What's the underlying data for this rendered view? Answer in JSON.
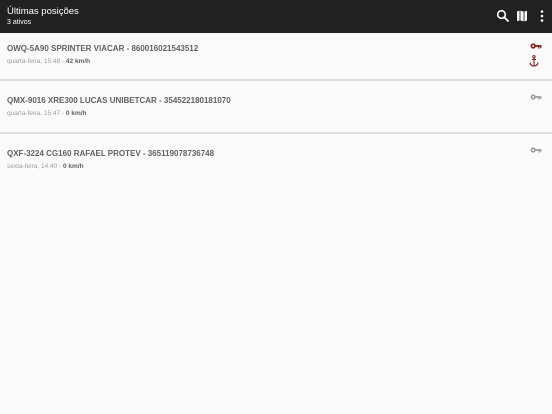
{
  "appbar": {
    "title": "Últimas posições",
    "subtitle": "3 ativos",
    "icons": [
      "search-icon",
      "map-icon",
      "more-vert-icon"
    ]
  },
  "colors": {
    "appbar_bg": "#212121",
    "key_active": "#8b1a1a",
    "key_inactive": "#9e9e9e",
    "anchor": "#8b1a1a"
  },
  "vehicles": [
    {
      "title": "OWQ-5A90 SPRINTER VIACAR - 860016021543512",
      "time": "quarta-feira, 15:48 - ",
      "speed": "42 km/h",
      "key_state": "active",
      "anchored": true
    },
    {
      "title": "QMX-9016 XRE300 LUCAS UNIBETCAR - 354522180181070",
      "time": "quarta-feira, 15:47 - ",
      "speed": "0 km/h",
      "key_state": "inactive",
      "anchored": false
    },
    {
      "title": "QXF-3224  CG160 RAFAEL PROTEV - 365119078736748",
      "time": "sexta-feira, 14:40 - ",
      "speed": "0 km/h",
      "key_state": "inactive",
      "anchored": false
    }
  ]
}
